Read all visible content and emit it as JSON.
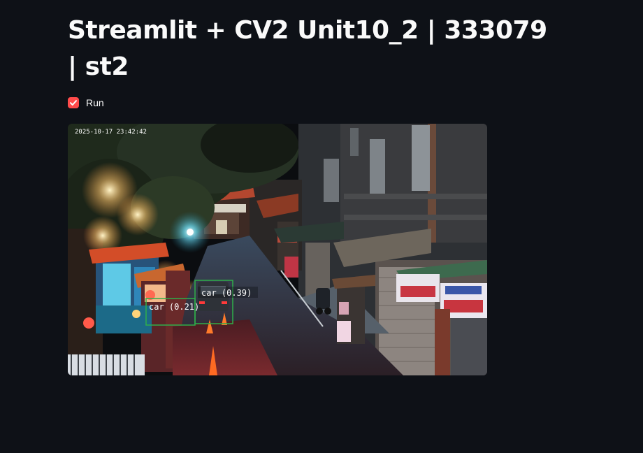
{
  "page": {
    "title": "Streamlit + CV2 Unit10_2 | 333079 | st2"
  },
  "controls": {
    "run_label": "Run",
    "run_checked": true,
    "accent_color": "#ff4b4b"
  },
  "video": {
    "timestamp": "2025-10-17 23:42:42",
    "detections": [
      {
        "label": "car (0.39)"
      },
      {
        "label": "car (0.21)"
      }
    ],
    "box_color": "#2fae4a"
  }
}
